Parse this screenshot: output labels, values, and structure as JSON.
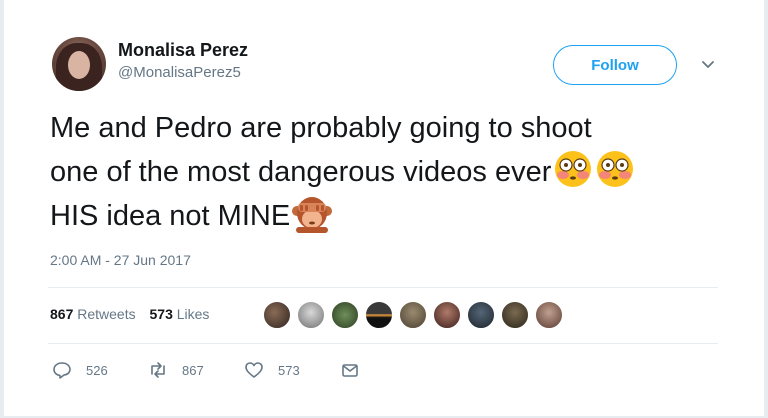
{
  "user": {
    "name": "Monalisa Perez",
    "handle": "@MonalisaPerez5"
  },
  "follow_label": "Follow",
  "tweet": {
    "line1": "Me and Pedro are probably going to shoot",
    "line2": "one of the most dangerous videos ever",
    "line3": "HIS idea not MINE"
  },
  "timestamp": "2:00 AM - 27 Jun 2017",
  "stats": {
    "retweets_count": "867",
    "retweets_label": "Retweets",
    "likes_count": "573",
    "likes_label": "Likes"
  },
  "actions": {
    "reply_count": "526",
    "retweet_count": "867",
    "like_count": "573"
  },
  "colors": {
    "accent": "#1da1f2",
    "muted": "#657786",
    "text": "#14171a",
    "divider": "#e6ecf0"
  },
  "icons": [
    "reply-icon",
    "retweet-icon",
    "heart-icon",
    "dm-envelope-icon",
    "chevron-down-icon",
    "flushed-face-emoji",
    "see-no-evil-monkey-emoji"
  ]
}
